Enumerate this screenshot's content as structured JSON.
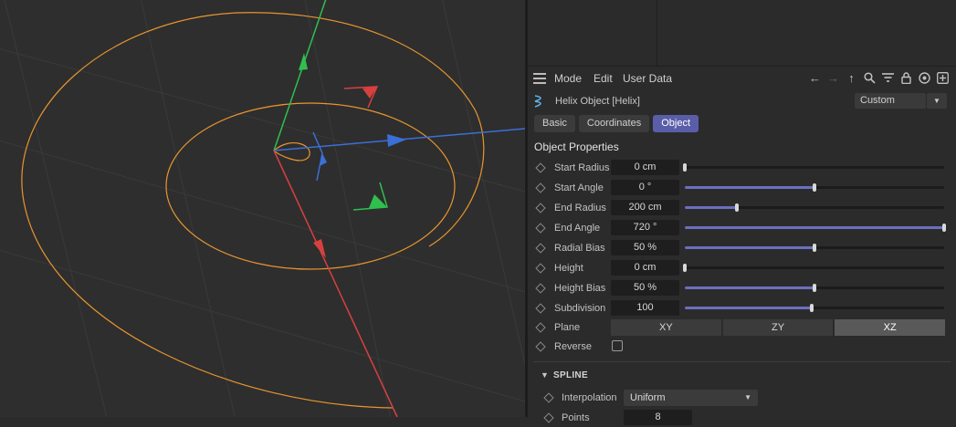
{
  "menu": {
    "mode": "Mode",
    "edit": "Edit",
    "user_data": "User Data"
  },
  "toolbar_icons": [
    "back-arrow-icon",
    "forward-arrow-icon",
    "up-arrow-icon",
    "search-icon",
    "filter-icon",
    "lock-icon",
    "target-icon",
    "add-icon"
  ],
  "object": {
    "title": "Helix Object [Helix]",
    "layout": "Custom",
    "icon": "helix-icon"
  },
  "tabs": [
    {
      "label": "Basic",
      "active": false
    },
    {
      "label": "Coordinates",
      "active": false
    },
    {
      "label": "Object",
      "active": true
    }
  ],
  "section_title": "Object Properties",
  "properties": [
    {
      "label": "Start Radius",
      "value": "0 cm",
      "fraction": 0.0
    },
    {
      "label": "Start Angle",
      "value": "0 °",
      "fraction": 0.5
    },
    {
      "label": "End Radius",
      "value": "200 cm",
      "fraction": 0.2
    },
    {
      "label": "End Angle",
      "value": "720 °",
      "fraction": 1.0
    },
    {
      "label": "Radial Bias",
      "value": "50 %",
      "fraction": 0.5
    },
    {
      "label": "Height",
      "value": "0 cm",
      "fraction": 0.0
    },
    {
      "label": "Height Bias",
      "value": "50 %",
      "fraction": 0.5
    },
    {
      "label": "Subdivision",
      "value": "100",
      "fraction": 0.5
    }
  ],
  "plane": {
    "label": "Plane",
    "options": [
      "XY",
      "ZY",
      "XZ"
    ],
    "selected": "XZ"
  },
  "reverse": {
    "label": "Reverse",
    "checked": false
  },
  "spline": {
    "header": "SPLINE",
    "interpolation_label": "Interpolation",
    "interpolation_value": "Uniform",
    "points_label": "Points",
    "points_value": "8"
  },
  "colors": {
    "accent": "#5a5ea8",
    "slider_fill": "#6b6fc0",
    "helix_curve": "#e8952e",
    "axis_x": "#3b6fd8",
    "axis_y": "#2fbf4f",
    "axis_z": "#d84040"
  }
}
